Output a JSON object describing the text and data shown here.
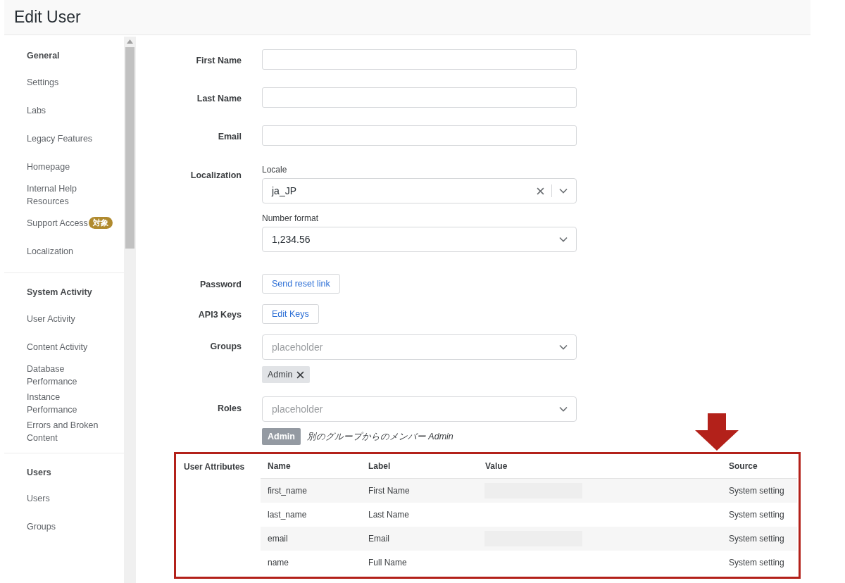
{
  "header": {
    "title": "Edit User"
  },
  "sidebar": {
    "sections": [
      {
        "heading": "General",
        "items": [
          {
            "label": "Settings"
          },
          {
            "label": "Labs"
          },
          {
            "label": "Legacy Features"
          },
          {
            "label": "Homepage"
          },
          {
            "label": "Internal Help Resources"
          },
          {
            "label": "Support Access",
            "badge": "対象"
          },
          {
            "label": "Localization"
          }
        ]
      },
      {
        "heading": "System Activity",
        "items": [
          {
            "label": "User Activity"
          },
          {
            "label": "Content Activity"
          },
          {
            "label": "Database Performance"
          },
          {
            "label": "Instance Performance"
          },
          {
            "label": "Errors and Broken Content"
          }
        ]
      },
      {
        "heading": "Users",
        "items": [
          {
            "label": "Users"
          },
          {
            "label": "Groups"
          }
        ]
      }
    ]
  },
  "form": {
    "text_fields": [
      {
        "label": "First Name"
      },
      {
        "label": "Last Name"
      },
      {
        "label": "Email"
      }
    ],
    "localization": {
      "label": "Localization",
      "locale": {
        "caption": "Locale",
        "value": "ja_JP",
        "clearable": true
      },
      "number_format": {
        "caption": "Number format",
        "value": "1,234.56"
      }
    },
    "password": {
      "label": "Password",
      "button": "Send reset link"
    },
    "api_keys": {
      "label": "API3 Keys",
      "button": "Edit Keys"
    },
    "groups": {
      "label": "Groups",
      "placeholder": "placeholder",
      "tags": [
        {
          "text": "Admin",
          "removable": true
        }
      ]
    },
    "roles": {
      "label": "Roles",
      "placeholder": "placeholder",
      "tags": [
        {
          "text": "Admin",
          "removable": false
        }
      ],
      "note": "別のグループからのメンバー Admin"
    }
  },
  "user_attributes": {
    "label": "User Attributes",
    "columns": [
      "Name",
      "Label",
      "Value",
      "Source"
    ],
    "rows": [
      {
        "name": "first_name",
        "label": "First Name",
        "value_redacted": true,
        "source": "System setting"
      },
      {
        "name": "last_name",
        "label": "Last Name",
        "value_redacted": false,
        "source": "System setting"
      },
      {
        "name": "email",
        "label": "Email",
        "value_redacted": true,
        "source": "System setting"
      },
      {
        "name": "name",
        "label": "Full Name",
        "value_redacted": false,
        "source": "System setting"
      }
    ]
  }
}
